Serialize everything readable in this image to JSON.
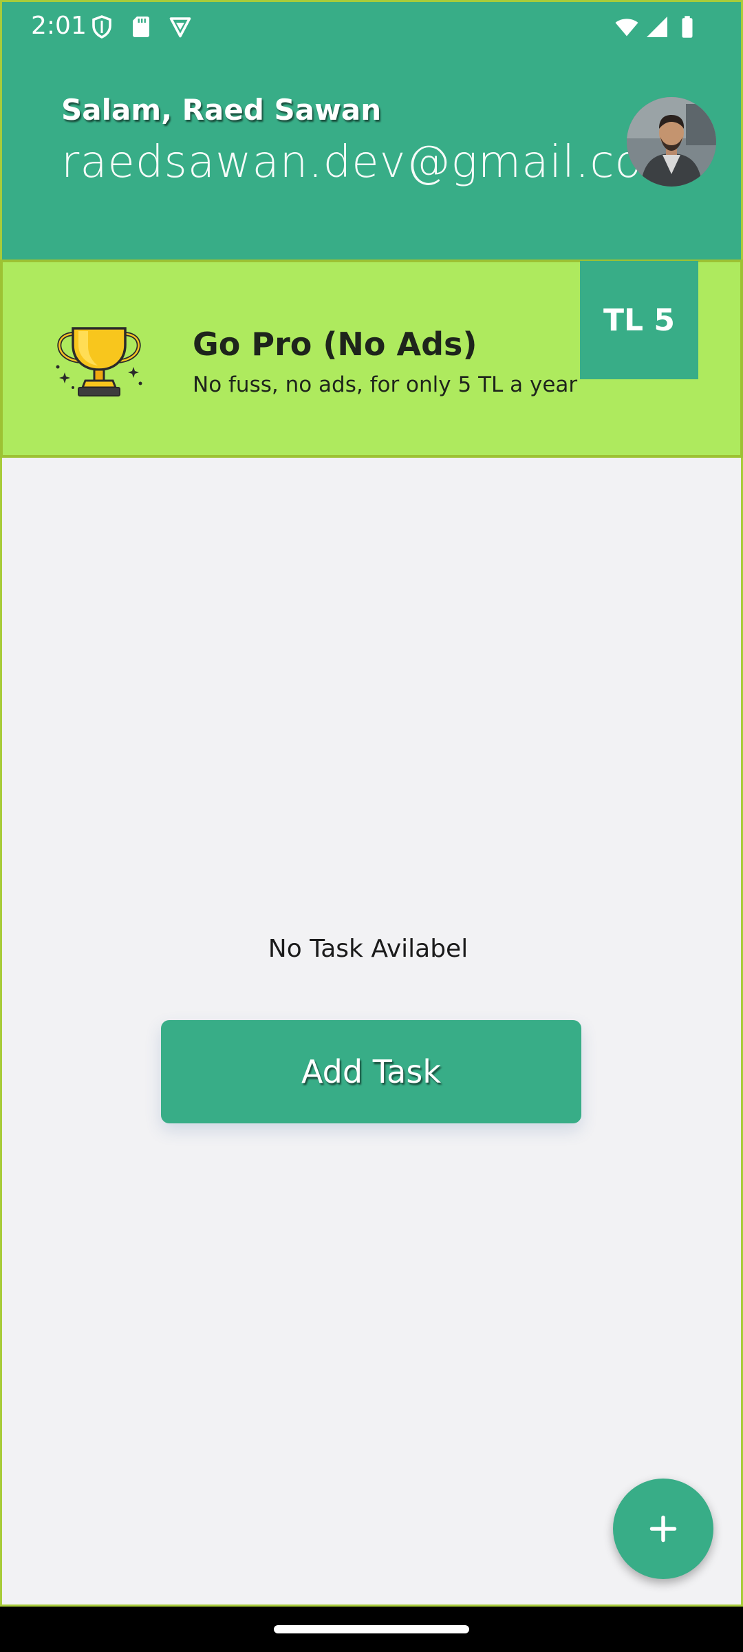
{
  "status_bar": {
    "time": "2:01",
    "icons": [
      "shield-icon",
      "sd-card-icon",
      "vpn-icon",
      "wifi-icon",
      "signal-icon",
      "battery-icon"
    ]
  },
  "header": {
    "greeting": "Salam, Raed Sawan",
    "email": "raedsawan.dev@gmail.com",
    "background_color": "#38ad87"
  },
  "promo": {
    "title": "Go Pro (No Ads)",
    "subtitle": "No fuss, no ads, for only 5 TL a year",
    "price": "TL 5",
    "background_color": "#aeea5e",
    "icon": "trophy-icon"
  },
  "main": {
    "empty_message": "No Task Avilabel",
    "add_task_label": "Add Task"
  },
  "fab": {
    "icon": "plus-icon"
  },
  "colors": {
    "accent": "#38ad87",
    "promo": "#aeea5e",
    "border": "#a8cc3a"
  }
}
